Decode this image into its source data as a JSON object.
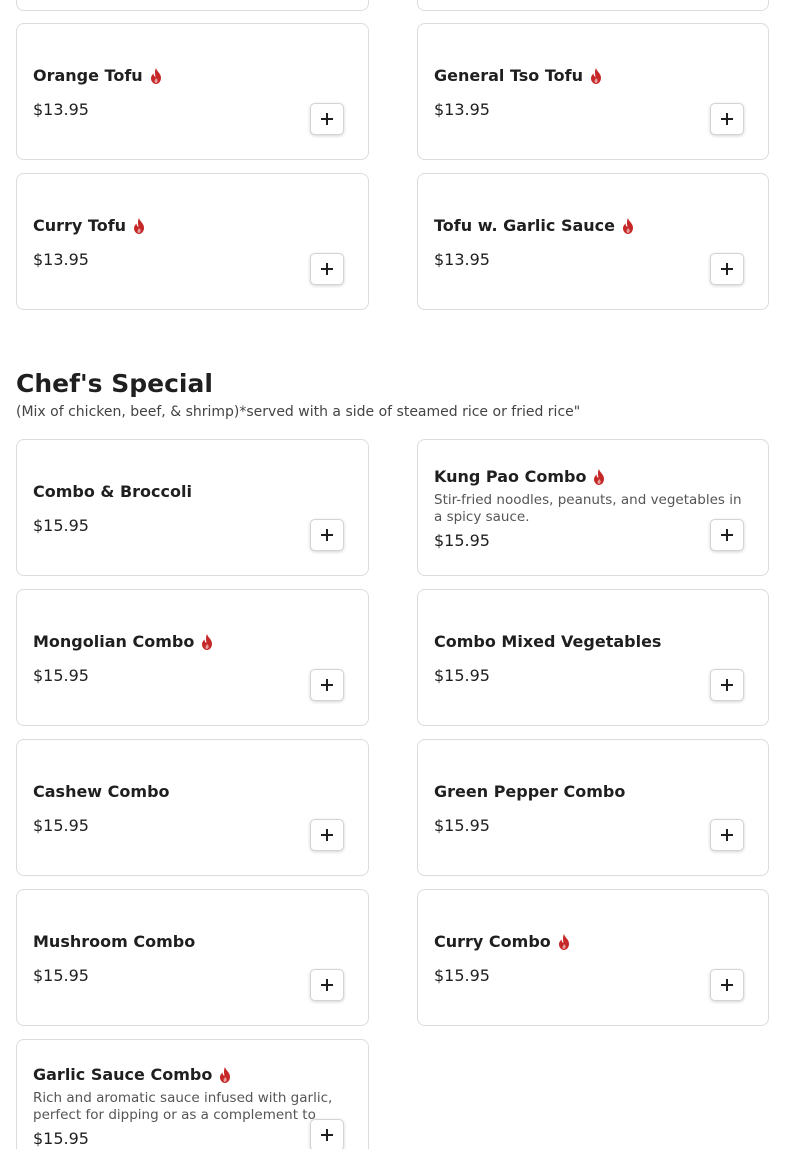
{
  "tofu_section": {
    "items": [
      {
        "name": "Orange Tofu",
        "price": "$13.95",
        "spicy": true
      },
      {
        "name": "General Tso Tofu",
        "price": "$13.95",
        "spicy": true
      },
      {
        "name": "Curry Tofu",
        "price": "$13.95",
        "spicy": true
      },
      {
        "name": "Tofu w. Garlic Sauce",
        "price": "$13.95",
        "spicy": true
      }
    ]
  },
  "chefs_special": {
    "title": "Chef's Special",
    "subtitle": "(Mix of chicken, beef, & shrimp)*served with a side of steamed rice or fried rice\"",
    "items": [
      {
        "name": "Combo & Broccoli",
        "price": "$15.95",
        "spicy": false
      },
      {
        "name": "Kung Pao Combo",
        "price": "$15.95",
        "spicy": true,
        "description": "Stir-fried noodles, peanuts, and vegetables in a spicy sauce."
      },
      {
        "name": "Mongolian Combo",
        "price": "$15.95",
        "spicy": true
      },
      {
        "name": "Combo Mixed Vegetables",
        "price": "$15.95",
        "spicy": false
      },
      {
        "name": "Cashew Combo",
        "price": "$15.95",
        "spicy": false
      },
      {
        "name": "Green Pepper Combo",
        "price": "$15.95",
        "spicy": false
      },
      {
        "name": "Mushroom Combo",
        "price": "$15.95",
        "spicy": false
      },
      {
        "name": "Curry Combo",
        "price": "$15.95",
        "spicy": true
      },
      {
        "name": "Garlic Sauce Combo",
        "price": "$15.95",
        "spicy": true,
        "description": "Rich and aromatic sauce infused with garlic, perfect for dipping or as a complement to"
      }
    ]
  },
  "icons": {
    "spicy": "flame-icon",
    "add": "plus-icon"
  },
  "colors": {
    "flame": "#c62828",
    "border": "#dcdcdc",
    "text": "#1f1f1f",
    "muted": "#555555"
  }
}
